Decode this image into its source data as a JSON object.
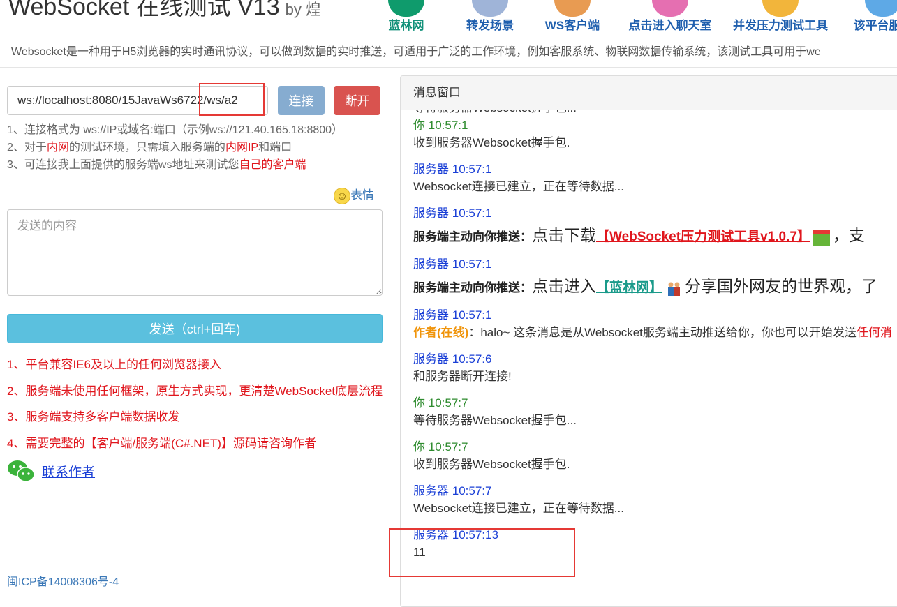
{
  "header": {
    "title": "WebSocket 在线测试 V13",
    "by": "by 煌",
    "nav": [
      {
        "label": "蓝林网",
        "color": "#12917a"
      },
      {
        "label": "转发场景",
        "color": "#1f5fae"
      },
      {
        "label": "WS客户端",
        "color": "#1f5fae"
      },
      {
        "label": "点击进入聊天室",
        "color": "#1f5fae"
      },
      {
        "label": "并发压力测试工具",
        "color": "#1f5fae"
      },
      {
        "label": "该平台服务",
        "color": "#1f5fae"
      }
    ],
    "intro": "Websocket是一种用于H5浏览器的实时通讯协议，可以做到数据的实时推送，可适用于广泛的工作环境，例如客服系统、物联网数据传输系统，该测试工具可用于we"
  },
  "connection": {
    "url": "ws://localhost:8080/15JavaWs6722/ws/a2",
    "connect_label": "连接",
    "disconnect_label": "断开",
    "tips": {
      "line1": "1、连接格式为 ws://IP或域名:端口（示例ws://121.40.165.18:8800）",
      "line2_a": "2、对于",
      "line2_b": "内网",
      "line2_c": "的测试环境，只需填入服务端的",
      "line2_d": "内网IP",
      "line2_e": "和端口",
      "line3_a": "3、可连接我上面提供的服务端ws地址来测试您",
      "line3_b": "自己的客户端"
    }
  },
  "compose": {
    "emoji_label": "表情",
    "placeholder": "发送的内容",
    "send_label": "发送（ctrl+回车)"
  },
  "features": [
    "1、平台兼容IE6及以上的任何浏览器接入",
    "2、服务端未使用任何框架，原生方式实现，更清楚WebSocket底层流程",
    "3、服务端支持多客户端数据收发",
    "4、需要完整的【客户端/服务端(C#.NET)】源码请咨询作者"
  ],
  "contact_label": "联系作者",
  "icp": "闽ICP备14008306号-4",
  "message_window": {
    "title": "消息窗口",
    "partial_top": "等待服务器Websocket握手包...",
    "messages": [
      {
        "who": "你",
        "time": "10:57:1",
        "text": "收到服务器Websocket握手包."
      },
      {
        "who": "服务器",
        "time": "10:57:1",
        "text": "Websocket连接已建立，正在等待数据..."
      },
      {
        "who": "服务器",
        "time": "10:57:1",
        "push_label": "服务端主动向你推送：",
        "push_lead": "点击下载",
        "push_link": "【WebSocket压力测试工具v1.0.7】",
        "push_tail": "，支"
      },
      {
        "who": "服务器",
        "time": "10:57:1",
        "push_label": "服务端主动向你推送：",
        "push_lead": "点击进入",
        "push_link": "【蓝林网】",
        "push_tail": "分享国外网友的世界观，了"
      },
      {
        "who": "服务器",
        "time": "10:57:1",
        "author": "作者(在线)",
        "text_a": "：halo~ 这条消息是从Websocket服务端主动推送给你，你也可以开始发送",
        "text_b": "任何消"
      },
      {
        "who": "服务器",
        "time": "10:57:6",
        "text": "和服务器断开连接!"
      },
      {
        "who": "你",
        "time": "10:57:7",
        "text": "等待服务器Websocket握手包..."
      },
      {
        "who": "你",
        "time": "10:57:7",
        "text": "收到服务器Websocket握手包."
      },
      {
        "who": "服务器",
        "time": "10:57:7",
        "text": "Websocket连接已建立，正在等待数据..."
      },
      {
        "who": "服务器",
        "time": "10:57:13",
        "text": "11"
      }
    ]
  }
}
